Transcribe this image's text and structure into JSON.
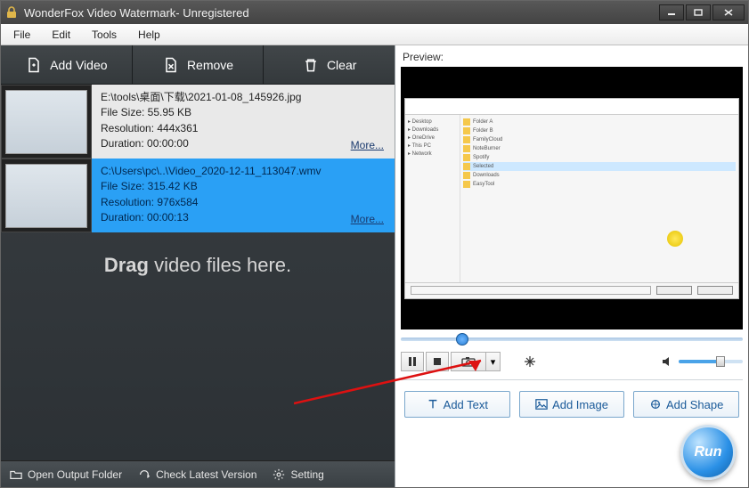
{
  "titlebar": {
    "title": "WonderFox Video Watermark- Unregistered"
  },
  "menu": {
    "file": "File",
    "edit": "Edit",
    "tools": "Tools",
    "help": "Help"
  },
  "toolbar": {
    "add": "Add Video",
    "remove": "Remove",
    "clear": "Clear"
  },
  "files": [
    {
      "path": "E:\\tools\\桌面\\下载\\2021-01-08_145926.jpg",
      "size": "File Size: 55.95 KB",
      "resolution": "Resolution: 444x361",
      "duration": "Duration: 00:00:00",
      "more": "More..."
    },
    {
      "path": "C:\\Users\\pc\\..\\Video_2020-12-11_113047.wmv",
      "size": "File Size: 315.42 KB",
      "resolution": "Resolution: 976x584",
      "duration": "Duration: 00:00:13",
      "more": "More..."
    }
  ],
  "draghint": {
    "bold": "Drag",
    "rest": " video files here."
  },
  "bottombar": {
    "open": "Open Output Folder",
    "check": "Check Latest Version",
    "setting": "Setting"
  },
  "preview": {
    "label": "Preview:"
  },
  "addrow": {
    "text": "Add Text",
    "image": "Add Image",
    "shape": "Add Shape"
  },
  "run": {
    "label": "Run"
  }
}
